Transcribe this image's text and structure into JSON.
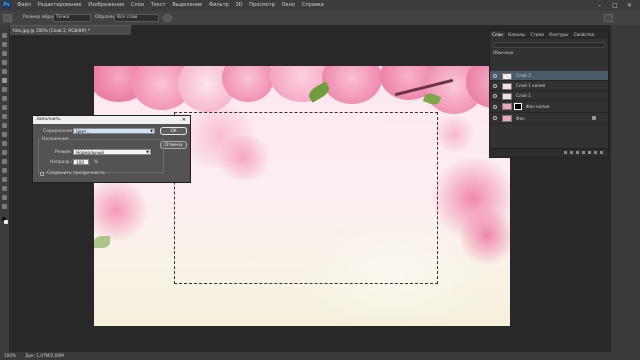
{
  "menubar": {
    "logo": "Ps",
    "items": [
      "Файл",
      "Редактирование",
      "Изображение",
      "Слои",
      "Текст",
      "Выделение",
      "Фильтр",
      "3D",
      "Просмотр",
      "Окно",
      "Справка"
    ],
    "window_controls": [
      "–",
      "□",
      "✕"
    ]
  },
  "options": {
    "label_size": "Размер образца:",
    "size_value": "Точка",
    "label_sample": "Образец:",
    "sample_value": "Все слои"
  },
  "document": {
    "tab_title": "foto.jpg @ 100% (Слой 2, RGB/8#) *"
  },
  "layers_panel": {
    "tabs": [
      "Слои",
      "Каналы",
      "Стили",
      "Контуры",
      "Свойства"
    ],
    "active_tab": "Слои",
    "filter_label": "Обычные",
    "layers": [
      {
        "name": "Слой 2",
        "selected": true
      },
      {
        "name": "Слой 1 копия",
        "selected": false
      },
      {
        "name": "Слой 1",
        "selected": false
      },
      {
        "name": "Фон копия",
        "selected": false,
        "has_mask": true
      },
      {
        "name": "Фон",
        "selected": false,
        "locked": true
      }
    ]
  },
  "fill_dialog": {
    "title": "Заполнить",
    "content_label": "Содержание:",
    "content_value": "Цвет...",
    "ok_label": "OK",
    "cancel_label": "Отмена",
    "blending_label": "Наложение",
    "mode_label": "Режим:",
    "mode_value": "Нормальный",
    "opacity_label": "Непрозр.:",
    "opacity_value": "100",
    "opacity_unit": "%",
    "preserve_label": "Сохранить прозрачность"
  },
  "status_bar": {
    "zoom": "100%",
    "doc_info": "Док: 1,07M/2,00M"
  },
  "colors": {
    "app_bg": "#282828",
    "selected_layer": "#4b5a6b",
    "petal_pink": "#f48fb0"
  }
}
